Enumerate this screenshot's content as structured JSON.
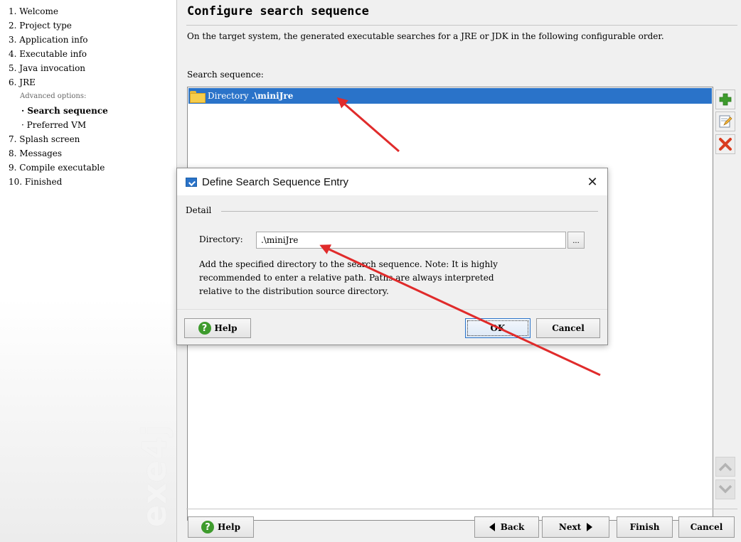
{
  "sidebar": {
    "steps": [
      "1. Welcome",
      "2. Project type",
      "3. Application info",
      "4. Executable info",
      "5. Java invocation",
      "6. JRE",
      "Advanced options:",
      "· Search sequence",
      "· Preferred VM",
      "7. Splash screen",
      "8. Messages",
      "9. Compile executable",
      "10. Finished"
    ],
    "current_step": "Search sequence",
    "brand": "exe4j"
  },
  "main": {
    "title": "Configure search sequence",
    "description": "On the target system, the generated executable searches for a JRE or JDK in the following configurable order.",
    "sequence_label": "Search sequence:",
    "sequence_entries": [
      {
        "type": "Directory",
        "value": ".\\miniJre",
        "selected": true
      }
    ],
    "side_buttons": [
      {
        "icon": "add-icon",
        "enabled": true
      },
      {
        "icon": "edit-icon",
        "enabled": true
      },
      {
        "icon": "delete-icon",
        "enabled": true
      },
      {
        "icon": "move-up-icon",
        "enabled": false
      },
      {
        "icon": "move-down-icon",
        "enabled": false
      }
    ]
  },
  "nav": {
    "help": "Help",
    "back": "Back",
    "next": "Next",
    "finish": "Finish",
    "cancel": "Cancel"
  },
  "dialog": {
    "title": "Define Search Sequence Entry",
    "section": "Detail",
    "directory_label": "Directory:",
    "directory_value": ".\\miniJre",
    "browse_label": "...",
    "note": "Add the specified directory to the search sequence. Note: It is highly\nrecommended to enter a relative path. Paths are always interpreted\nrelative to the distribution source directory.",
    "help": "Help",
    "ok": "OK",
    "cancel": "Cancel"
  },
  "colors": {
    "selection": "#2a73c9",
    "help_icon": "#3e9b2d",
    "add_icon": "#3e9b2d",
    "delete_icon": "#d93c1f",
    "annotation_arrow": "#e02b2b"
  }
}
